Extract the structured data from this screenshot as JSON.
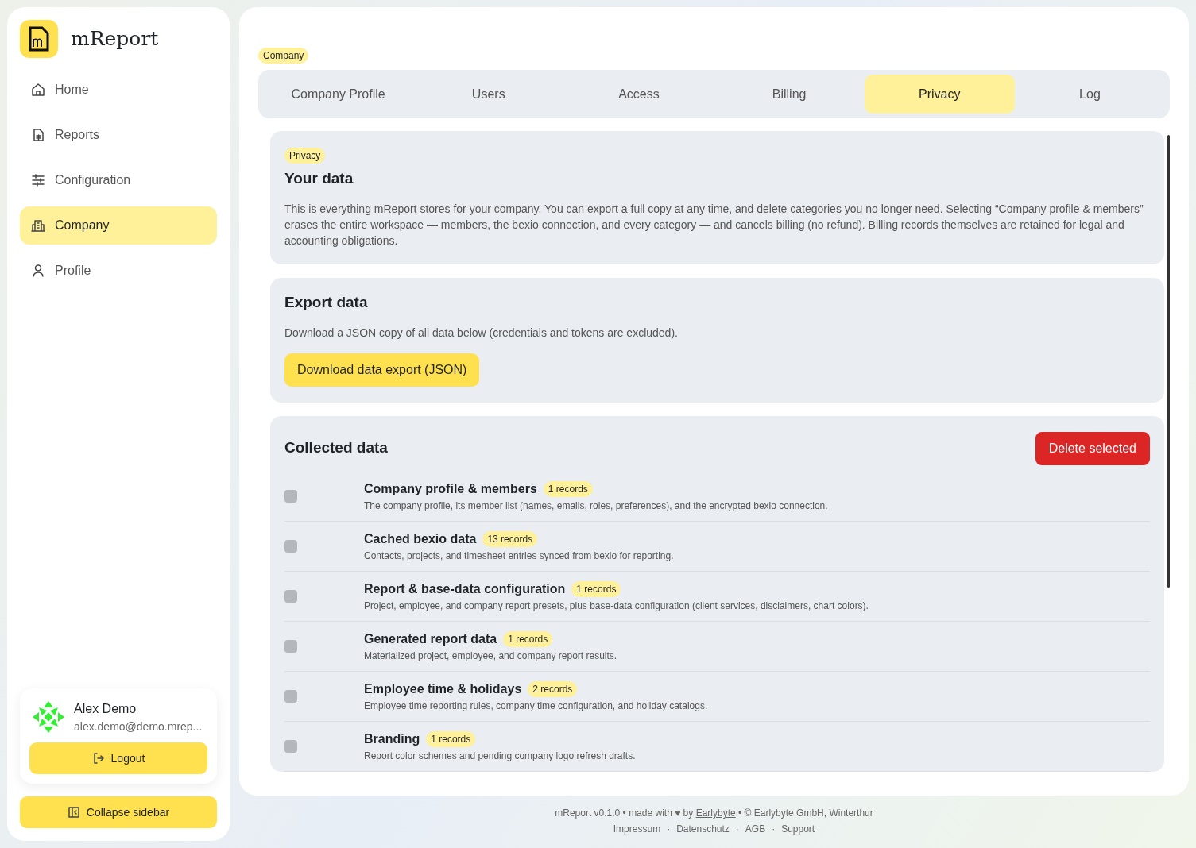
{
  "brand": {
    "name": "mReport"
  },
  "nav": [
    {
      "label": "Home",
      "selected": false
    },
    {
      "label": "Reports",
      "selected": false
    },
    {
      "label": "Configuration",
      "selected": false
    },
    {
      "label": "Company",
      "selected": true
    },
    {
      "label": "Profile",
      "selected": false
    }
  ],
  "user": {
    "name": "Alex Demo",
    "email": "alex.demo@demo.mrep...",
    "logout": "Logout"
  },
  "collapse": "Collapse sidebar",
  "breadcrumb": "Company",
  "tabs": [
    {
      "label": "Company Profile",
      "selected": false
    },
    {
      "label": "Users",
      "selected": false
    },
    {
      "label": "Access",
      "selected": false
    },
    {
      "label": "Billing",
      "selected": false
    },
    {
      "label": "Privacy",
      "selected": true
    },
    {
      "label": "Log",
      "selected": false
    }
  ],
  "intro": {
    "tag": "Privacy",
    "title": "Your data",
    "text": "This is everything mReport stores for your company. You can export a full copy at any time, and delete categories you no longer need. Selecting “Company profile & members” erases the entire workspace — members, the bexio connection, and every category — and cancels billing (no refund). Billing records themselves are retained for legal and accounting obligations."
  },
  "export": {
    "title": "Export data",
    "text": "Download a JSON copy of all data below (credentials and tokens are excluded).",
    "button": "Download data export (JSON)"
  },
  "collected": {
    "title": "Collected data",
    "delete_button": "Delete selected",
    "items": [
      {
        "name": "Company profile & members",
        "count": "1 records",
        "description": "The company profile, its member list (names, emails, roles, preferences), and the encrypted bexio connection.",
        "checked": false
      },
      {
        "name": "Cached bexio data",
        "count": "13 records",
        "description": "Contacts, projects, and timesheet entries synced from bexio for reporting.",
        "checked": false
      },
      {
        "name": "Report & base-data configuration",
        "count": "1 records",
        "description": "Project, employee, and company report presets, plus base-data configuration (client services, disclaimers, chart colors).",
        "checked": false
      },
      {
        "name": "Generated report data",
        "count": "1 records",
        "description": "Materialized project, employee, and company report results.",
        "checked": false
      },
      {
        "name": "Employee time & holidays",
        "count": "2 records",
        "description": "Employee time reporting rules, company time configuration, and holiday catalogs.",
        "checked": false
      },
      {
        "name": "Branding",
        "count": "1 records",
        "description": "Report color schemes and pending company logo refresh drafts.",
        "checked": false
      }
    ]
  },
  "footer": {
    "version": "mReport v0.1.0 •",
    "made_with": "made with",
    "heart": "♥",
    "by": "by",
    "author_link": "Earlybyte",
    "copyright": "• © Earlybyte GmbH, Winterthur",
    "links": [
      {
        "label": "Impressum"
      },
      {
        "separator": "·",
        "label": "Datenschutz"
      },
      {
        "separator": "·",
        "label": "AGB"
      },
      {
        "separator": "·",
        "label": "Support"
      }
    ]
  }
}
